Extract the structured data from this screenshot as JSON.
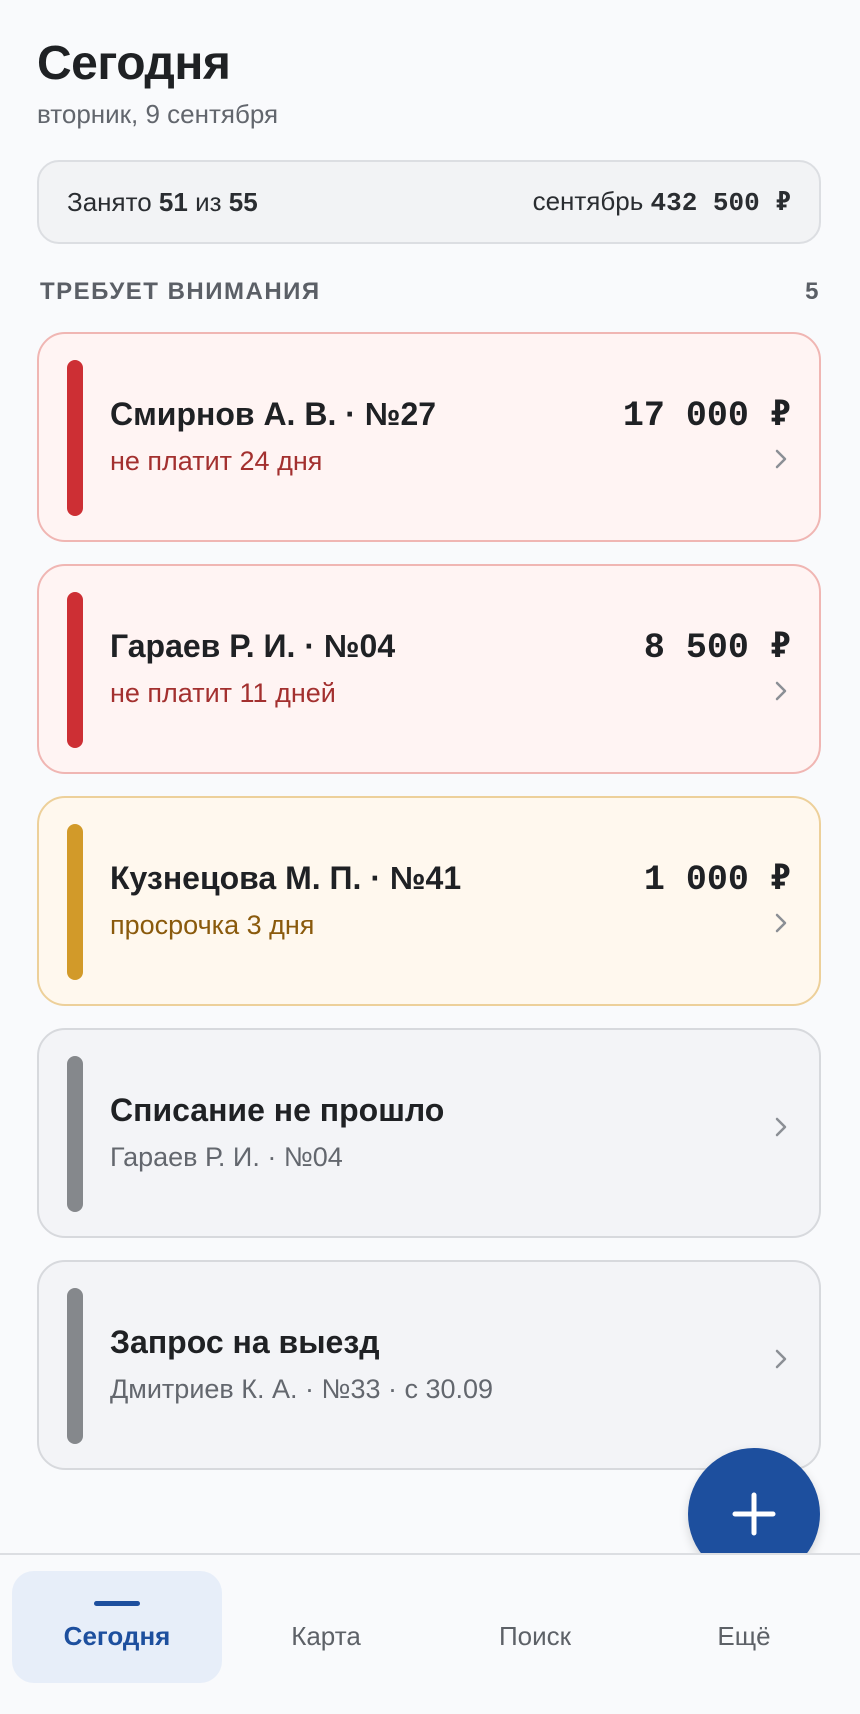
{
  "header": {
    "title": "Сегодня",
    "date": "вторник, 9 сентября"
  },
  "summary": {
    "occupied_label": "Занято",
    "occupied": "51",
    "of_label": "из",
    "total": "55",
    "month_label": "сентябрь",
    "month_amount": "432 500 ₽"
  },
  "attention": {
    "heading": "ТРЕБУЕТ ВНИМАНИЯ",
    "count": "5",
    "items": [
      {
        "title": "Смирнов А. В. · №27",
        "subtitle": "не платит 24 дня",
        "amount": "17 000 ₽",
        "severity": "red"
      },
      {
        "title": "Гараев Р. И. · №04",
        "subtitle": "не платит 11 дней",
        "amount": "8 500 ₽",
        "severity": "red"
      },
      {
        "title": "Кузнецова М. П. · №41",
        "subtitle": "просрочка 3 дня",
        "amount": "1 000 ₽",
        "severity": "amber"
      },
      {
        "title": "Списание не прошло",
        "subtitle": "Гараев Р. И. · №04",
        "amount": "",
        "severity": "gray"
      },
      {
        "title": "Запрос на выезд",
        "subtitle": "Дмитриев К. А. · №33 · с 30.09",
        "amount": "",
        "severity": "gray"
      }
    ]
  },
  "fab": {
    "icon": "plus-icon"
  },
  "nav": {
    "items": [
      {
        "label": "Сегодня",
        "active": true
      },
      {
        "label": "Карта",
        "active": false
      },
      {
        "label": "Поиск",
        "active": false
      },
      {
        "label": "Ещё",
        "active": false
      }
    ]
  },
  "colors": {
    "accent": "#1d4f9e",
    "danger": "#cd2f34",
    "warning": "#d29a29",
    "neutral": "#85888c"
  }
}
